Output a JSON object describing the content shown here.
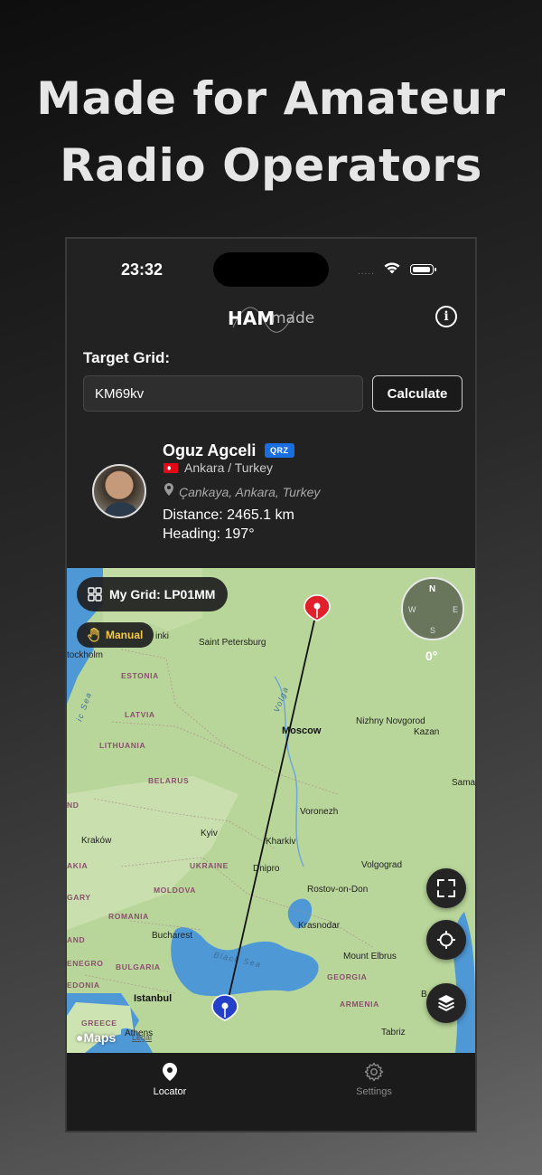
{
  "headline": {
    "line1": "Made for Amateur",
    "line2": "Radio Operators"
  },
  "status_bar": {
    "time": "23:32",
    "signal_dots": "....."
  },
  "app": {
    "logo_ham": "HAM",
    "logo_made": "made",
    "info_icon": "info-circle-icon"
  },
  "target": {
    "label": "Target Grid:",
    "value": "KM69kv",
    "button": "Calculate"
  },
  "profile": {
    "name": "Oguz Agceli",
    "badge": "QRZ",
    "country": "Ankara / Turkey",
    "locality": "Çankaya, Ankara, Turkey",
    "distance": "Distance: 2465.1 km",
    "heading": "Heading: 197°"
  },
  "map": {
    "my_grid": "My Grid: LP01MM",
    "mode": "Manual",
    "compass": {
      "n": "N",
      "e": "E",
      "s": "S",
      "w": "W",
      "heading": "0°"
    },
    "attribution": "Maps",
    "legal": "Legal",
    "labels": {
      "stockholm": "tockholm",
      "helsinki": "inki",
      "saint_petersburg": "Saint Petersburg",
      "estonia": "ESTONIA",
      "latvia": "LATVIA",
      "lithuania": "LITHUANIA",
      "belarus": "BELARUS",
      "baltic": "ic Sea",
      "volga": "Volga",
      "moscow": "Moscow",
      "nizhny": "Nizhny Novgorod",
      "kazan": "Kazan",
      "samara": "Samara",
      "voronezh": "Voronezh",
      "kyiv": "Kyiv",
      "krakow": "Kraków",
      "kharkiv": "Kharkiv",
      "ukraine": "UKRAINE",
      "dnipro": "Dnipro",
      "volgograd": "Volgograd",
      "moldova": "MOLDOVA",
      "rostov": "Rostov-on-Don",
      "romania": "ROMANIA",
      "bucharest": "Bucharest",
      "krasnodar": "Krasnodar",
      "black_sea": "Black Sea",
      "mount_elbrus": "Mount Elbrus",
      "bulgaria": "BULGARIA",
      "georgia": "GEORGIA",
      "istanbul": "Istanbul",
      "armenia": "ARMENIA",
      "greece": "GREECE",
      "athens": "Athens",
      "tabriz": "Tabriz",
      "nd": "ND",
      "akia": "AKIA",
      "gary": "GARY",
      "and": "AND",
      "enegro": "ENEGRO",
      "edonia": "EDONIA",
      "b": "B"
    },
    "controls": [
      "fullscreen-icon",
      "locate-icon",
      "layers-icon"
    ]
  },
  "tabs": [
    {
      "label": "Locator",
      "icon": "location-pin-icon",
      "active": true
    },
    {
      "label": "Settings",
      "icon": "gear-icon",
      "active": false
    }
  ],
  "colors": {
    "badge_blue": "#1a6fe0",
    "manual_yellow": "#f7c948",
    "target_pin_red": "#e0202a",
    "home_pin_blue": "#2540c8",
    "water": "#4f98d6",
    "land": "#b9d69a"
  }
}
